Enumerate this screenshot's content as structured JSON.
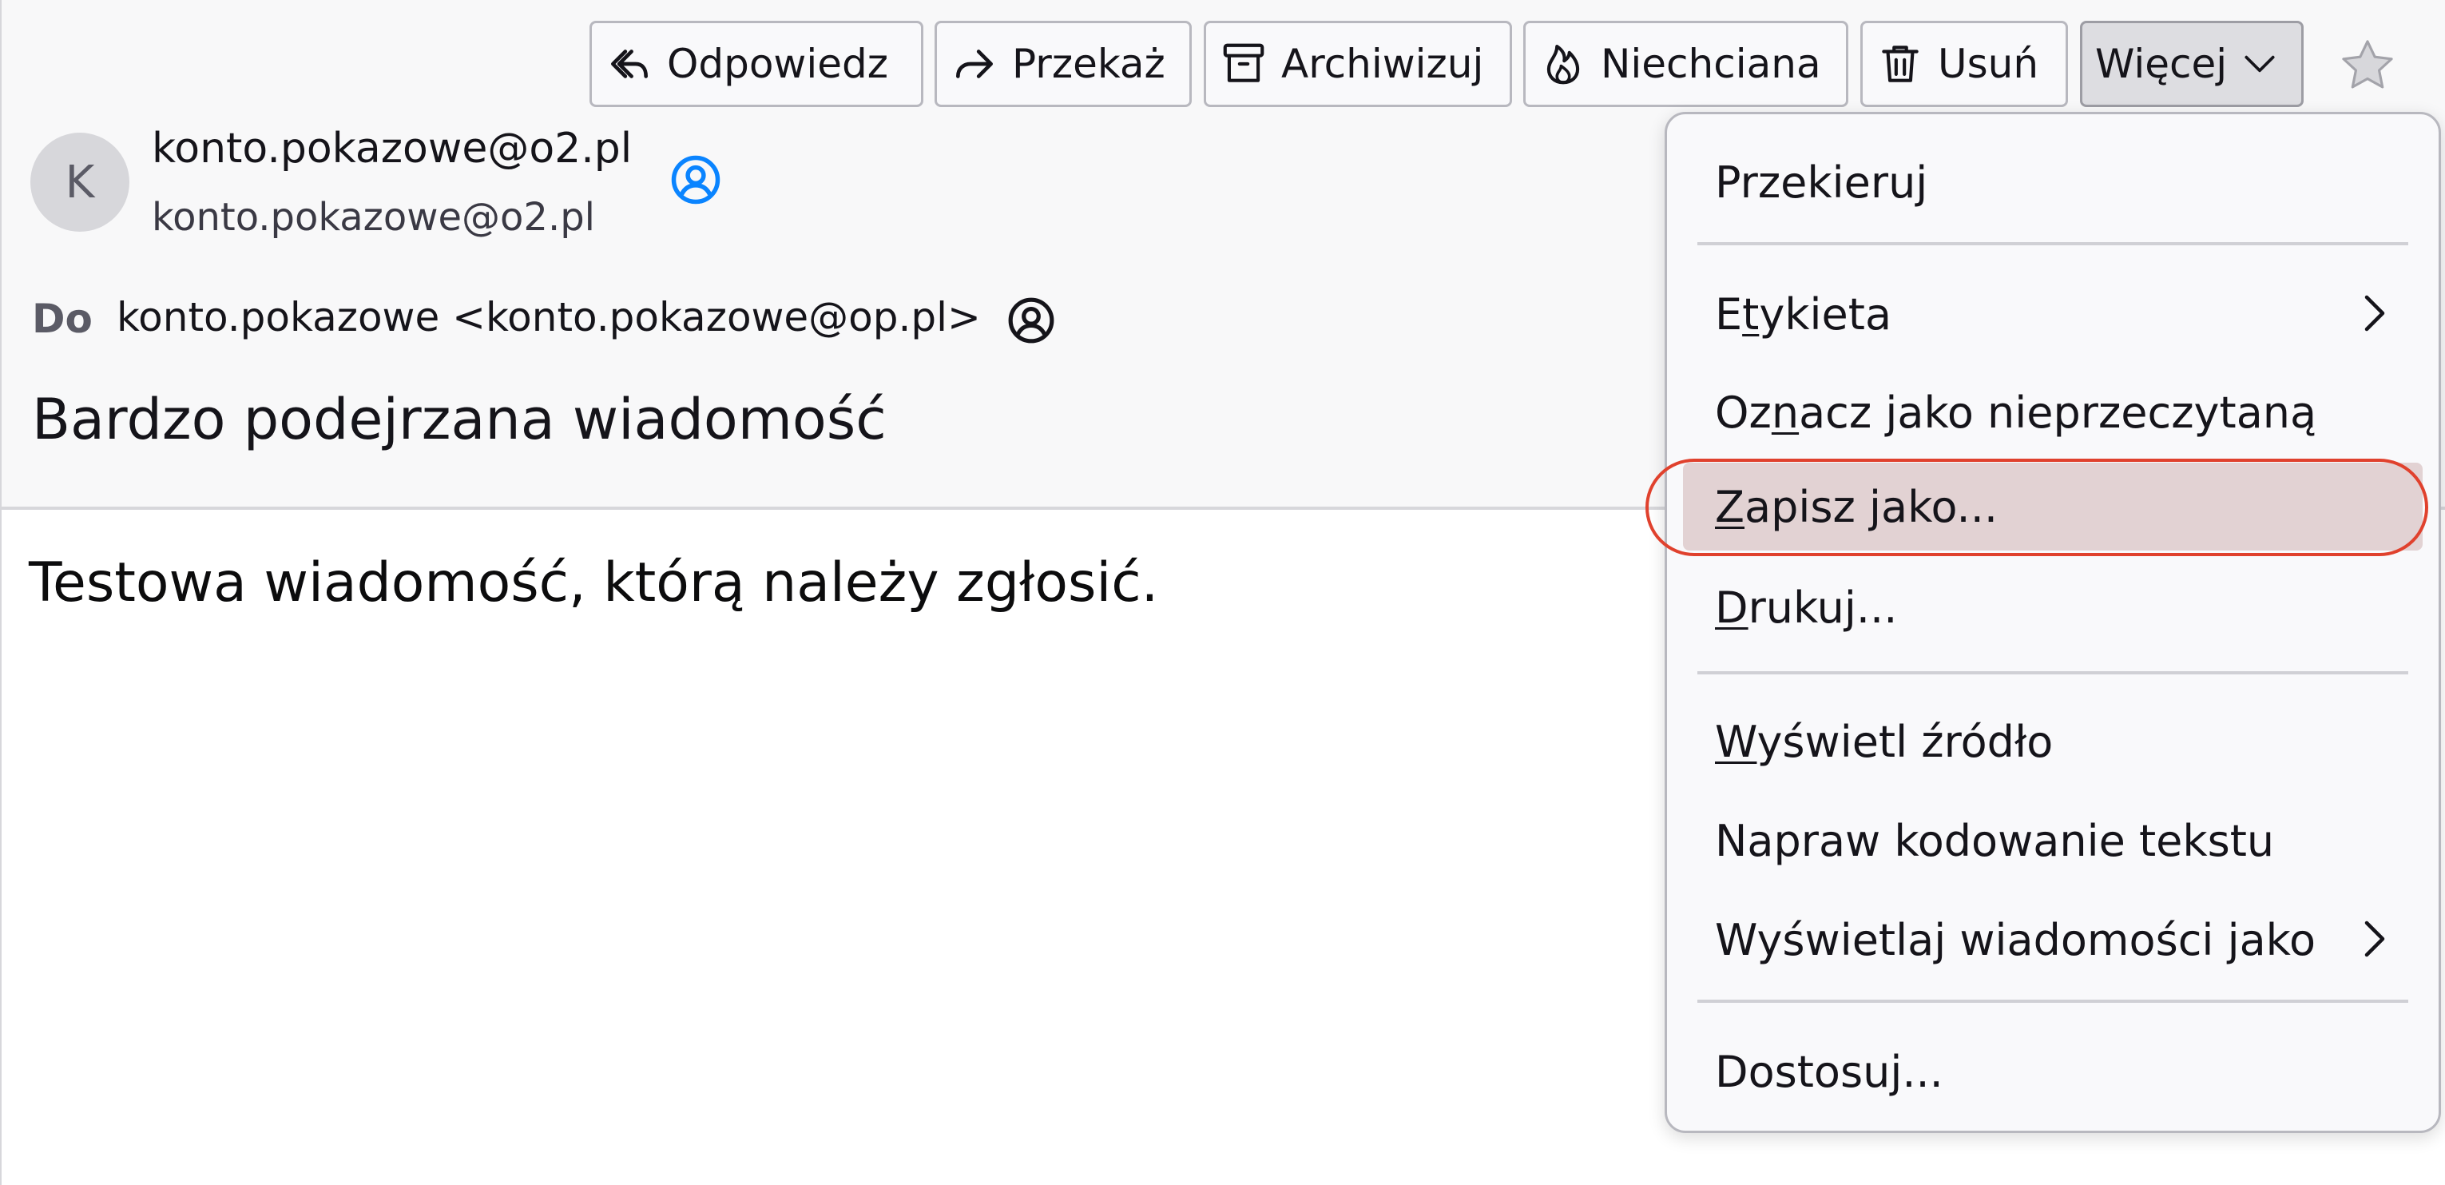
{
  "toolbar": {
    "reply_label": "Odpowiedz",
    "forward_label": "Przekaż",
    "archive_label": "Archiwizuj",
    "junk_label": "Niechciana",
    "delete_label": "Usuń",
    "more_label": "Więcej"
  },
  "message": {
    "avatar_letter": "K",
    "from_name": "konto.pokazowe@o2.pl",
    "from_address": "konto.pokazowe@o2.pl",
    "to_label": "Do",
    "to_value": "konto.pokazowe <konto.pokazowe@op.pl>",
    "subject": "Bardzo podejrzana wiadomość",
    "body": "Testowa wiadomość, którą należy zgłosić."
  },
  "menu": {
    "redirect": "Przekieruj",
    "tag": {
      "pre": "E",
      "key": "t",
      "post": "ykieta"
    },
    "mark_unread": {
      "pre": "Oz",
      "key": "n",
      "post": "acz jako nieprzeczytaną"
    },
    "save_as": {
      "pre": "",
      "key": "Z",
      "post": "apisz jako..."
    },
    "print": {
      "pre": "",
      "key": "D",
      "post": "rukuj..."
    },
    "view_source": {
      "pre": "",
      "key": "W",
      "post": "yświetl źródło"
    },
    "repair_encoding": "Napraw kodowanie tekstu",
    "view_as": "Wyświetlaj wiadomości jako",
    "customize": "Dostosuj..."
  },
  "colors": {
    "accent_blue": "#0a84ff",
    "highlight_ring": "#e0412d",
    "highlight_fill": "#e2d2d3"
  }
}
